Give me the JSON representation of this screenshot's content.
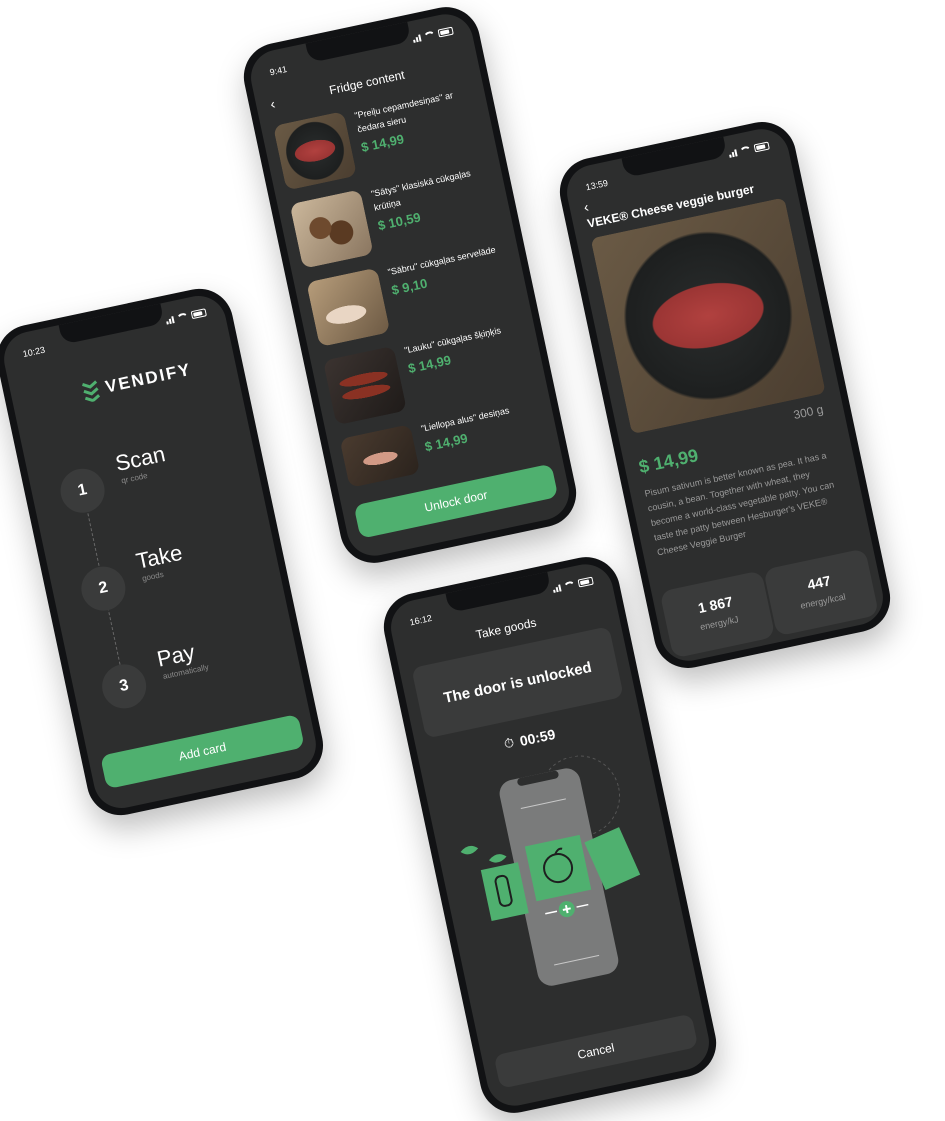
{
  "colors": {
    "accent": "#4fb06f",
    "screen_bg": "#2d2e2e",
    "card_bg": "#3a3b3b"
  },
  "onboarding": {
    "time": "10:23",
    "logo": "VENDIFY",
    "steps": [
      {
        "num": "1",
        "title": "Scan",
        "sub": "qr code"
      },
      {
        "num": "2",
        "title": "Take",
        "sub": "goods"
      },
      {
        "num": "3",
        "title": "Pay",
        "sub": "automatically"
      }
    ],
    "button": "Add card"
  },
  "fridge": {
    "time": "9:41",
    "title": "Fridge content",
    "back_icon": "chevron-left-icon",
    "items": [
      {
        "name": "\"Preiļu cepamdesiņas\" ar čedara sieru",
        "price": "$ 14,99"
      },
      {
        "name": "\"Sātys\" klasiskā cūkgaļas krūtiņa",
        "price": "$ 10,59"
      },
      {
        "name": "\"Sābru\" cūkgaļas servelāde",
        "price": "$ 9,10"
      },
      {
        "name": "\"Lauku\" cūkgaļas šķiņķis",
        "price": "$ 14,99"
      },
      {
        "name": "\"Liellopa alus\" desiņas",
        "price": "$ 14,99"
      }
    ],
    "button": "Unlock door"
  },
  "product": {
    "time": "13:59",
    "title": "VEKE® Cheese veggie burger",
    "weight": "300 g",
    "price": "$ 14,99",
    "description": "Pisum sativum is better known as pea. It has a cousin, a bean. Together with wheat, they become a world-class vegetable patty. You can taste the patty between Hesburger's VEKE® Cheese Veggie Burger",
    "stats": [
      {
        "value": "1 867",
        "label": "energy/kJ"
      },
      {
        "value": "447",
        "label": "energy/kcal"
      }
    ]
  },
  "take_goods": {
    "time": "16:12",
    "title": "Take goods",
    "message": "The door is unlocked",
    "timer": "00:59",
    "button": "Cancel"
  }
}
